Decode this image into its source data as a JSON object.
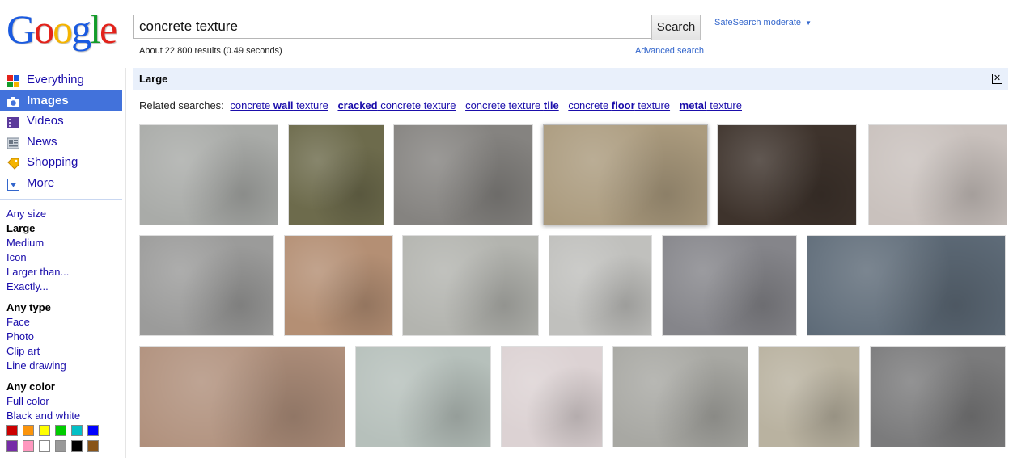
{
  "logo": {
    "letters": [
      "G",
      "o",
      "o",
      "g",
      "l",
      "e"
    ]
  },
  "search": {
    "query": "concrete texture",
    "button_label": "Search"
  },
  "safesearch": {
    "label": "SafeSearch moderate",
    "arrow": "▼"
  },
  "results": {
    "stats": "About 22,800 results (0.49 seconds)",
    "advanced_label": "Advanced search"
  },
  "nav": {
    "items": [
      {
        "label": "Everything",
        "icon": "everything-icon"
      },
      {
        "label": "Images",
        "icon": "camera-icon"
      },
      {
        "label": "Videos",
        "icon": "film-icon"
      },
      {
        "label": "News",
        "icon": "newspaper-icon"
      },
      {
        "label": "Shopping",
        "icon": "tag-icon"
      },
      {
        "label": "More",
        "icon": "dropdown-icon"
      }
    ]
  },
  "filters": {
    "size": [
      "Any size",
      "Large",
      "Medium",
      "Icon",
      "Larger than...",
      "Exactly..."
    ],
    "type": [
      "Any type",
      "Face",
      "Photo",
      "Clip art",
      "Line drawing"
    ],
    "color": [
      "Any color",
      "Full color",
      "Black and white"
    ]
  },
  "swatch_colors": [
    "#cc0000",
    "#fb940b",
    "#ffff00",
    "#00cc00",
    "#03c0c6",
    "#0000ff",
    "#762ca7",
    "#ff98bf",
    "#ffffff",
    "#999999",
    "#000000",
    "#885418"
  ],
  "filter_bar": {
    "title": "Large",
    "close": "✕"
  },
  "related": {
    "prefix": "Related searches:",
    "r1": {
      "a": "concrete ",
      "b": "wall",
      "c": " texture"
    },
    "r2": {
      "a": "cracked",
      "b": " concrete texture"
    },
    "r3": {
      "a": "concrete texture ",
      "b": "tile"
    },
    "r4": {
      "a": "concrete ",
      "b": "floor",
      "c": " texture"
    },
    "r5": {
      "a": "metal",
      "b": " texture"
    }
  },
  "thumbnails": [
    {
      "color": "#a9aba8"
    },
    {
      "color": "#6d6b4c"
    },
    {
      "color": "#858380"
    },
    {
      "color": "#ab9b7e"
    },
    {
      "color": "#3e332c"
    },
    {
      "color": "#c9c1bd"
    },
    {
      "color": "#9b9b9a"
    },
    {
      "color": "#b48f74"
    },
    {
      "color": "#b3b4af"
    },
    {
      "color": "#c0c0bd"
    },
    {
      "color": "#85858a"
    },
    {
      "color": "#5e6b78"
    },
    {
      "color": "#b0907c"
    },
    {
      "color": "#b6c0bb"
    },
    {
      "color": "#dcd2d3"
    },
    {
      "color": "#a8a8a3"
    },
    {
      "color": "#b9b2a0"
    },
    {
      "color": "#7b7b7c"
    }
  ]
}
